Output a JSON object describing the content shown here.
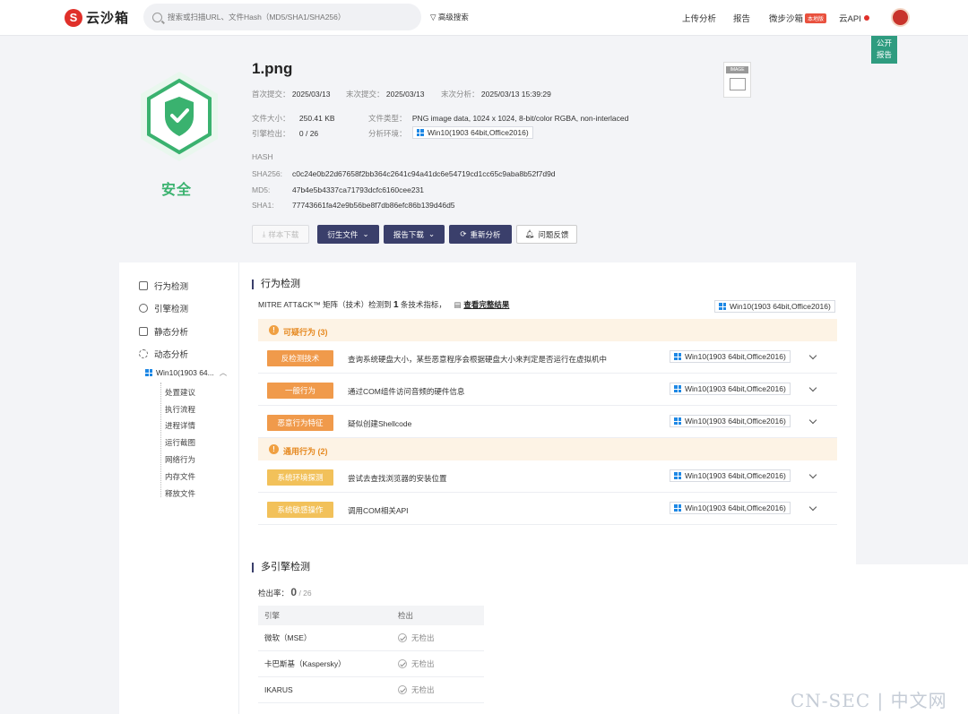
{
  "brand": {
    "logo_glyph": "S",
    "name": "云沙箱"
  },
  "search": {
    "placeholder": "搜索或扫描URL、文件Hash（MD5/SHA1/SHA256）"
  },
  "header": {
    "advanced_search": "高级搜索",
    "nav": [
      "上传分析",
      "报告",
      "微步沙箱",
      "云API"
    ],
    "local_badge": "本地版"
  },
  "public_report": [
    "公开",
    "报告"
  ],
  "verdict": {
    "label": "安全",
    "color": "#3ab26f"
  },
  "file": {
    "name": "1.png",
    "first_submit_label": "首次提交：",
    "first_submit": "2025/03/13",
    "last_submit_label": "末次提交：",
    "last_submit": "2025/03/13",
    "last_analysis_label": "末次分析：",
    "last_analysis": "2025/03/13 15:39:29",
    "size_label": "文件大小：",
    "size": "250.41 KB",
    "type_label": "文件类型：",
    "type": "PNG image data, 1024 x 1024, 8-bit/color RGBA, non-interlaced",
    "engine_label": "引擎检出：",
    "engine_hits": "0 / 26",
    "env_label": "分析环境：",
    "env": "Win10(1903 64bit,Office2016)",
    "thumb_tag": "IMAGE"
  },
  "hash": {
    "title": "HASH",
    "sha256_label": "SHA256:",
    "sha256": "c0c24e0b22d67658f2bb364c2641c94a41dc6e54719cd1cc65c9aba8b52f7d9d",
    "md5_label": "MD5:",
    "md5": "47b4e5b4337ca71793dcfc6160cee231",
    "sha1_label": "SHA1:",
    "sha1": "77743661fa42e9b56be8f7db86efc86b139d46d5"
  },
  "actions": {
    "sample_download": "样本下载",
    "derived_files": "衍生文件",
    "report_download": "报告下载",
    "reanalyze": "重新分析",
    "feedback": "问题反馈"
  },
  "sidebar": {
    "items": [
      "行为检测",
      "引擎检测",
      "静态分析",
      "动态分析"
    ],
    "env": "Win10(1903 64...",
    "subitems": [
      "处置建议",
      "执行流程",
      "进程详情",
      "运行截图",
      "网络行为",
      "内存文件",
      "释放文件"
    ]
  },
  "behavior": {
    "title": "行为检测",
    "mitre_prefix": "MITRE ATT&CK™ 矩阵（技术）检测到",
    "mitre_count": "1",
    "mitre_suffix": "条技术指标，",
    "view_full": "查看完整结果",
    "env": "Win10(1903 64bit,Office2016)",
    "suspicious_title": "可疑行为 (3)",
    "generic_title": "通用行为 (2)",
    "rows": [
      {
        "tag": "反检测技术",
        "desc": "查询系统硬盘大小，某些恶意程序会根据硬盘大小来判定是否运行在虚拟机中",
        "env": "Win10(1903 64bit,Office2016)"
      },
      {
        "tag": "一般行为",
        "desc": "通过COM组件访问音频的硬件信息",
        "env": "Win10(1903 64bit,Office2016)"
      },
      {
        "tag": "恶意行为特征",
        "desc": "疑似创建Shellcode",
        "env": "Win10(1903 64bit,Office2016)"
      },
      {
        "tag": "系统环境探测",
        "desc": "尝试去查找浏览器的安装位置",
        "env": "Win10(1903 64bit,Office2016)"
      },
      {
        "tag": "系统敏感操作",
        "desc": "调用COM相关API",
        "env": "Win10(1903 64bit,Office2016)"
      }
    ]
  },
  "engines": {
    "title": "多引擎检测",
    "rate_label": "检出率：",
    "rate_hits": "0",
    "rate_total": "/ 26",
    "col_engine": "引擎",
    "col_result": "检出",
    "rows": [
      {
        "engine": "微软（MSE）",
        "result": "无检出"
      },
      {
        "engine": "卡巴斯基（Kaspersky）",
        "result": "无检出"
      },
      {
        "engine": "IKARUS",
        "result": "无检出"
      }
    ]
  },
  "watermark": "CN-SEC | 中文网"
}
